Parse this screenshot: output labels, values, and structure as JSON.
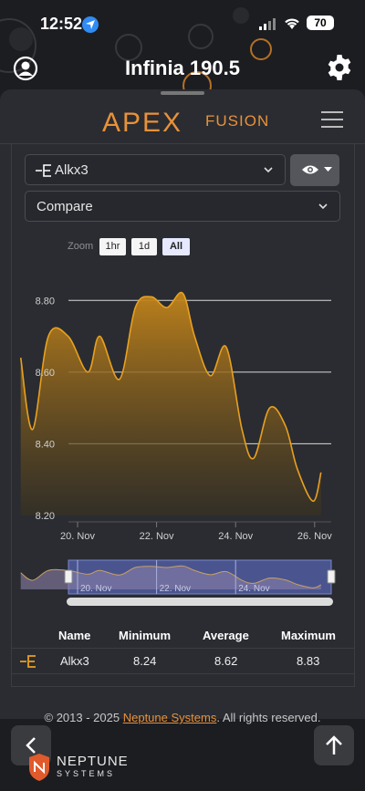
{
  "status_bar": {
    "time": "12:52",
    "battery": "70"
  },
  "header": {
    "title": "Infinia 190.5"
  },
  "branding": {
    "apex": "APEX",
    "fusion": "FUSION"
  },
  "controls": {
    "probe_select": "Alkx3",
    "compare_select": "Compare",
    "zoom_label": "Zoom",
    "zoom_options": [
      "1hr",
      "1d",
      "All"
    ],
    "zoom_selected": "All"
  },
  "chart_data": {
    "type": "area",
    "series": [
      {
        "name": "Alkx3",
        "x": [
          "19.0 Nov",
          "19.3 Nov",
          "19.7 Nov",
          "20.2 Nov",
          "20.7 Nov",
          "21.0 Nov",
          "21.5 Nov",
          "21.9 Nov",
          "22.3 Nov",
          "22.7 Nov",
          "23.1 Nov",
          "23.4 Nov",
          "23.8 Nov",
          "24.2 Nov",
          "24.6 Nov",
          "24.9 Nov",
          "25.3 Nov",
          "25.7 Nov",
          "26.0 Nov",
          "26.4 Nov",
          "26.6 Nov"
        ],
        "values": [
          8.64,
          8.44,
          8.7,
          8.7,
          8.6,
          8.7,
          8.58,
          8.78,
          8.81,
          8.78,
          8.82,
          8.7,
          8.59,
          8.67,
          8.44,
          8.36,
          8.5,
          8.45,
          8.33,
          8.24,
          8.32
        ]
      }
    ],
    "x_ticks": [
      "20. Nov",
      "22. Nov",
      "24. Nov",
      "26. Nov"
    ],
    "y_ticks": [
      "8.20",
      "8.40",
      "8.60",
      "8.80"
    ],
    "ylim": [
      8.2,
      8.9
    ],
    "navigator_ticks": [
      "20. Nov",
      "22. Nov",
      "24. Nov",
      "2..."
    ],
    "line_color": "#e8a020",
    "grid": true
  },
  "table": {
    "headers": [
      "Name",
      "Minimum",
      "Average",
      "Maximum"
    ],
    "rows": [
      {
        "name": "Alkx3",
        "minimum": "8.24",
        "average": "8.62",
        "maximum": "8.83"
      }
    ]
  },
  "footer": {
    "prefix": "© 2013 - 2025 ",
    "link": "Neptune Systems",
    "suffix": ". All rights reserved."
  },
  "brand": {
    "name": "NEPTUNE",
    "sub": "SYSTEMS"
  },
  "colors": {
    "accent": "#e8913a",
    "panel": "#2a2c31",
    "background": "#1c1d21"
  }
}
